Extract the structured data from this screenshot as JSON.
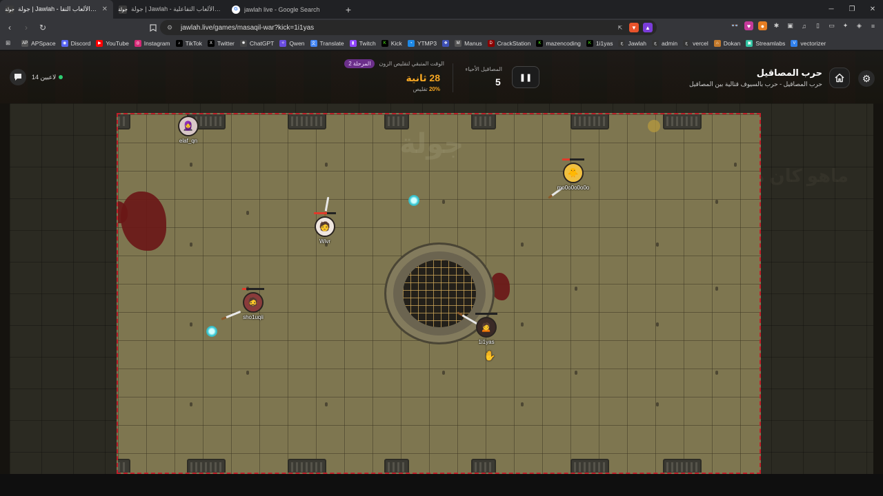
{
  "browser": {
    "tabs": [
      {
        "favicon": "جولة",
        "title": "جولة | Jawlah - منصة الألعاب التفا",
        "active": true
      },
      {
        "favicon": "جولة",
        "title": "جولة | Jawlah - منصة الألعاب التفاعلية",
        "active": false
      },
      {
        "favicon": "G",
        "title": "jawlah live - Google Search",
        "active": false
      }
    ],
    "url": "jawlah.live/games/masaqil-war?kick=1i1yas",
    "bookmarks": [
      "APSpace",
      "Discord",
      "YouTube",
      "Instagram",
      "TikTok",
      "Twitter",
      "ChatGPT",
      "Qwen",
      "Translate",
      "Twitch",
      "Kick",
      "YTMP3",
      "",
      "Manus",
      "CrackStation",
      "mazencoding",
      "1i1yas",
      "Jawlah",
      "admin",
      "vercel",
      "Dokan",
      "Streamlabs",
      "vectorizer"
    ]
  },
  "header": {
    "title": "حرب المصاقيل",
    "subtitle": "حرب المصاقيل - حرب بالسيوف قتالية بين المصاقيل",
    "alive_label": "المصاقيل الأحياء",
    "alive_count": "5",
    "zone_label": "الوقت المتبقي لتقليص الزون",
    "stage": "المرحلة 2",
    "time_left": "28 ثانية",
    "shrink_value": "20%",
    "shrink_label": "تقليص",
    "players_online": "14 لاعبين"
  },
  "arena": {
    "watermark": "جولة",
    "outer_watermark": "ماهو كان هنا",
    "players": [
      {
        "name": "elaf_qn",
        "emoji": "🧕",
        "hp": 0
      },
      {
        "name": "mo0o0o0o0o",
        "emoji": "🐥",
        "hp": 0.35
      },
      {
        "name": "Wivr",
        "emoji": "🧑",
        "hp": 0.6
      },
      {
        "name": "sho1uqii",
        "emoji": "🧔",
        "hp": 0.2
      },
      {
        "name": "1i1yas",
        "emoji": "🙍",
        "hp": 0.0
      }
    ]
  },
  "colors": {
    "zone_border": "#c0202a",
    "accent_orange": "#f5a623",
    "stage_purple": "#6b2f8a",
    "online_green": "#2ecc71"
  }
}
